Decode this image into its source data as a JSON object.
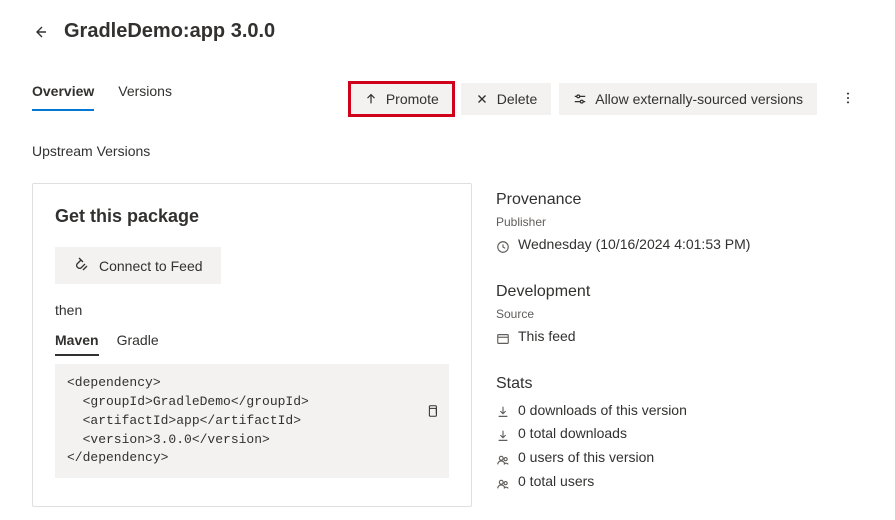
{
  "header": {
    "title": "GradleDemo:app 3.0.0"
  },
  "tabs": {
    "items": [
      {
        "label": "Overview",
        "active": true
      },
      {
        "label": "Versions",
        "active": false
      }
    ]
  },
  "commands": {
    "promote": "Promote",
    "delete": "Delete",
    "allow_external": "Allow externally-sourced versions"
  },
  "upstream_label": "Upstream Versions",
  "get_package": {
    "title": "Get this package",
    "connect_label": "Connect to Feed",
    "then_label": "then",
    "subtabs": [
      {
        "label": "Maven",
        "active": true
      },
      {
        "label": "Gradle",
        "active": false
      }
    ],
    "code": "<dependency>\n  <groupId>GradleDemo</groupId>\n  <artifactId>app</artifactId>\n  <version>3.0.0</version>\n</dependency>"
  },
  "provenance": {
    "heading": "Provenance",
    "publisher_label": "Publisher",
    "timestamp": "Wednesday (10/16/2024 4:01:53 PM)"
  },
  "development": {
    "heading": "Development",
    "source_label": "Source",
    "source_value": "This feed"
  },
  "stats": {
    "heading": "Stats",
    "items": [
      {
        "icon": "download",
        "text": "0 downloads of this version"
      },
      {
        "icon": "download",
        "text": "0 total downloads"
      },
      {
        "icon": "users",
        "text": "0 users of this version"
      },
      {
        "icon": "users",
        "text": "0 total users"
      }
    ]
  }
}
